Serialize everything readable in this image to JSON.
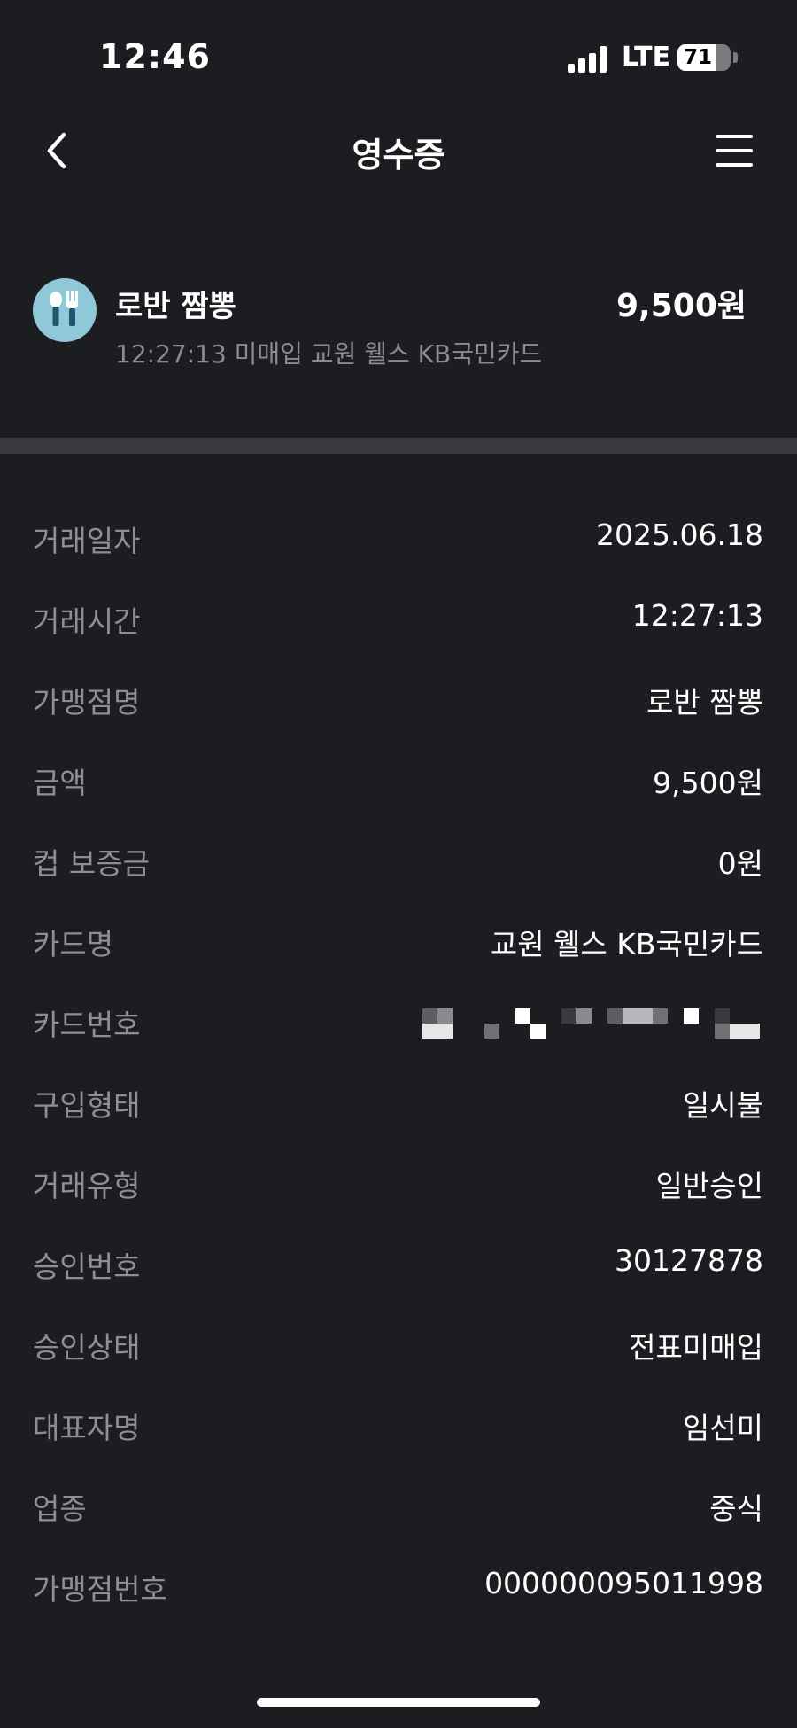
{
  "status": {
    "time": "12:46",
    "network": "LTE",
    "battery": "71",
    "battery_level": 0.71
  },
  "nav": {
    "title": "영수증",
    "back_icon": "chevron-left-icon",
    "menu_icon": "hamburger-menu-icon"
  },
  "merchant": {
    "name": "로반 짬뽕",
    "amount": "9,500원",
    "subtitle": "12:27:13 미매입 교원 웰스 KB국민카드",
    "icon": "restaurant-icon",
    "icon_color": "#8fc8d9"
  },
  "details": [
    {
      "label": "거래일자",
      "value": "2025.06.18"
    },
    {
      "label": "거래시간",
      "value": "12:27:13"
    },
    {
      "label": "가맹점명",
      "value": "로반 짬뽕"
    },
    {
      "label": "금액",
      "value": "9,500원"
    },
    {
      "label": "컵 보증금",
      "value": "0원"
    },
    {
      "label": "카드명",
      "value": "교원 웰스 KB국민카드"
    },
    {
      "label": "카드번호",
      "value": ""
    },
    {
      "label": "구입형태",
      "value": "일시불"
    },
    {
      "label": "거래유형",
      "value": "일반승인"
    },
    {
      "label": "승인번호",
      "value": "30127878"
    },
    {
      "label": "승인상태",
      "value": "전표미매입"
    },
    {
      "label": "대표자명",
      "value": "임선미"
    },
    {
      "label": "업종",
      "value": "중식"
    },
    {
      "label": "가맹점번호",
      "value": "000000095011998"
    }
  ],
  "colors": {
    "background": "#1c1d21",
    "label": "#8e8f94",
    "divider": "#38393d"
  }
}
